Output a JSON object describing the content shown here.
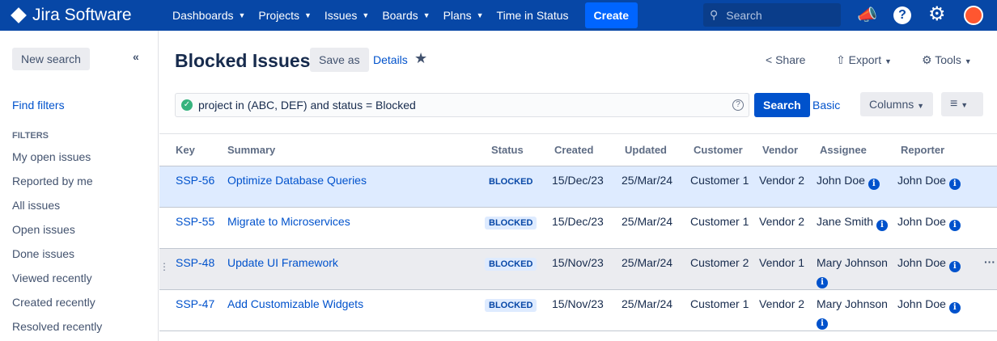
{
  "nav": {
    "brand": "Jira Software",
    "items": [
      "Dashboards",
      "Projects",
      "Issues",
      "Boards",
      "Plans"
    ],
    "time_in_status": "Time in Status",
    "create": "Create",
    "search_placeholder": "Search"
  },
  "sidebar": {
    "new_search": "New search",
    "find_filters": "Find filters",
    "filters_heading": "FILTERS",
    "filters": [
      "My open issues",
      "Reported by me",
      "All issues",
      "Open issues",
      "Done issues",
      "Viewed recently",
      "Created recently",
      "Resolved recently"
    ]
  },
  "header": {
    "title": "Blocked Issues",
    "save_as": "Save as",
    "details": "Details",
    "share": "Share",
    "export": "Export",
    "tools": "Tools"
  },
  "query": {
    "jql": "project in (ABC, DEF) and status = Blocked",
    "search": "Search",
    "basic": "Basic",
    "columns": "Columns"
  },
  "table": {
    "headers": [
      "Key",
      "Summary",
      "Status",
      "Created",
      "Updated",
      "Customer",
      "Vendor",
      "Assignee",
      "Reporter"
    ],
    "rows": [
      {
        "key": "SSP-56",
        "summary": "Optimize Database Queries",
        "status": "BLOCKED",
        "created": "15/Dec/23",
        "updated": "25/Mar/24",
        "customer": "Customer 1",
        "vendor": "Vendor 2",
        "assignee": "John Doe",
        "reporter": "John Doe"
      },
      {
        "key": "SSP-55",
        "summary": "Migrate to Microservices",
        "status": "BLOCKED",
        "created": "15/Dec/23",
        "updated": "25/Mar/24",
        "customer": "Customer 1",
        "vendor": "Vendor 2",
        "assignee": "Jane Smith",
        "reporter": "John Doe"
      },
      {
        "key": "SSP-48",
        "summary": "Update UI Framework",
        "status": "BLOCKED",
        "created": "15/Nov/23",
        "updated": "25/Mar/24",
        "customer": "Customer 2",
        "vendor": "Vendor 1",
        "assignee": "Mary Johnson",
        "reporter": "John Doe"
      },
      {
        "key": "SSP-47",
        "summary": "Add Customizable Widgets",
        "status": "BLOCKED",
        "created": "15/Nov/23",
        "updated": "25/Mar/24",
        "customer": "Customer 1",
        "vendor": "Vendor 2",
        "assignee": "Mary Johnson",
        "reporter": "John Doe"
      }
    ]
  }
}
